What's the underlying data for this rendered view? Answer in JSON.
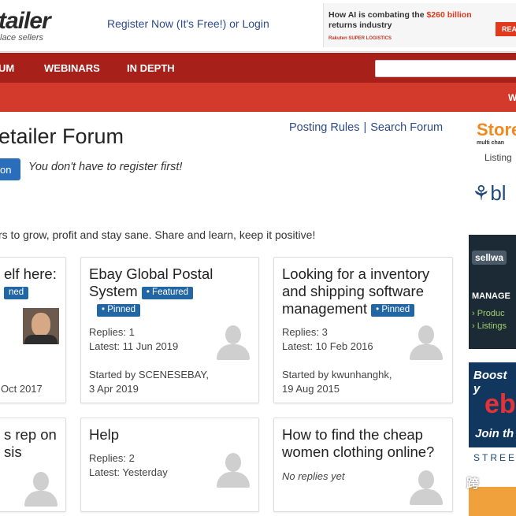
{
  "header": {
    "logo": "tailer",
    "logo_sub": "lace sellers",
    "register_link": "Register Now (It's Free!) or Login",
    "ad_line1_a": "How AI is combating the ",
    "ad_line1_b": "$260 billion",
    "ad_line2": "returns industry",
    "ad_brand": "Rakuten SUPER LOGISTICS",
    "ad_button": "REA"
  },
  "nav": {
    "items": [
      "UM",
      "WEBINARS",
      "IN DEPTH"
    ],
    "right_fragment": "W"
  },
  "forum": {
    "title": "etailer Forum",
    "posting_rules": "Posting Rules",
    "separator": "|",
    "search_forum": "Search Forum",
    "join_button": "on",
    "no_register": "You don't have to register first!",
    "tagline": "rs to grow, profit and stay sane. Share and learn, keep it positive!"
  },
  "cards": [
    {
      "title_line1": "elf here:",
      "badge": "ned",
      "date": "Oct 2017"
    },
    {
      "title_line1": "Ebay Global Postal",
      "title_line2": "System",
      "badge_featured": "• Featured",
      "badge_pinned": "• Pinned",
      "replies": "Replies: 1",
      "latest": "Latest: 11 Jun 2019",
      "started": "Started by SCENESEBAY,",
      "started_date": "3 Apr 2019"
    },
    {
      "title_line1": "Looking for a inventory",
      "title_line2": "and shipping software",
      "title_line3": "management",
      "badge_pinned": "• Pinned",
      "replies": "Replies: 3",
      "latest": "Latest: 10 Feb 2016",
      "started": "Started by kwunhanghk,",
      "started_date": "19 Aug 2015"
    },
    {
      "title_line1": "s rep on",
      "title_line2": "sis"
    },
    {
      "title_line1": "Help",
      "replies": "Replies: 2",
      "latest": "Latest: Yesterday"
    },
    {
      "title_line1": "How to find the cheap",
      "title_line2": "women clothing online?",
      "no_replies": "No replies yet"
    }
  ],
  "sidebar": {
    "storex": "Store",
    "storex_sub": "multi chan",
    "listing": "Listing",
    "bl": "bl",
    "sellw": "sellwa",
    "manage": "MANAGE",
    "produc": "› Produc",
    "listings": "› Listings",
    "boost": "Boost y",
    "ebay": "eb",
    "join": "Join th",
    "street": "STREE"
  },
  "watermark": "跨",
  "colors": {
    "nav_red": "#a8201a",
    "subnav_red": "#d33a2c",
    "link_blue": "#2b4a8b",
    "badge_blue": "#2266a3"
  }
}
